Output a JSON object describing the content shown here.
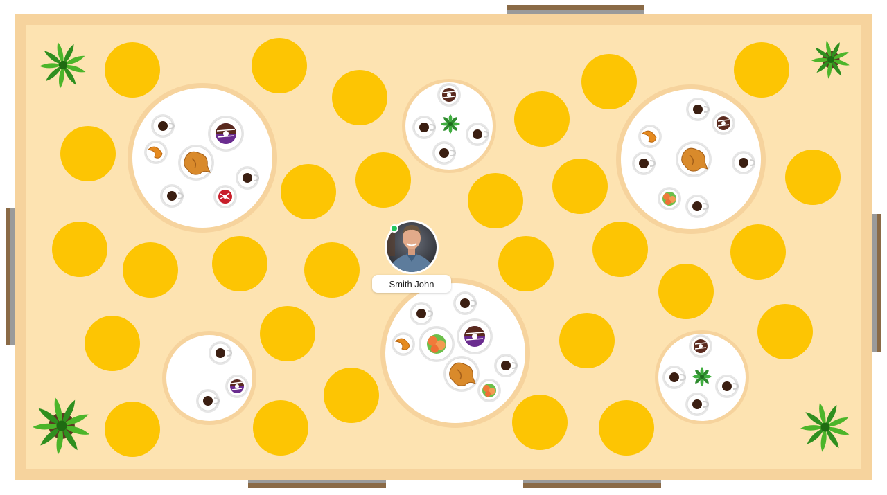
{
  "room": {
    "floor_color": "#fde3b1",
    "border_color": "#f6d39d",
    "seat_color": "#fdc503",
    "table_color": "#ffffff"
  },
  "user": {
    "name": "Smith John",
    "status": "online",
    "status_color": "#22c55e"
  },
  "food_items": [
    "coffee-cup",
    "croissant",
    "roast-chicken",
    "donut",
    "salad-plate",
    "mint-leaf"
  ]
}
